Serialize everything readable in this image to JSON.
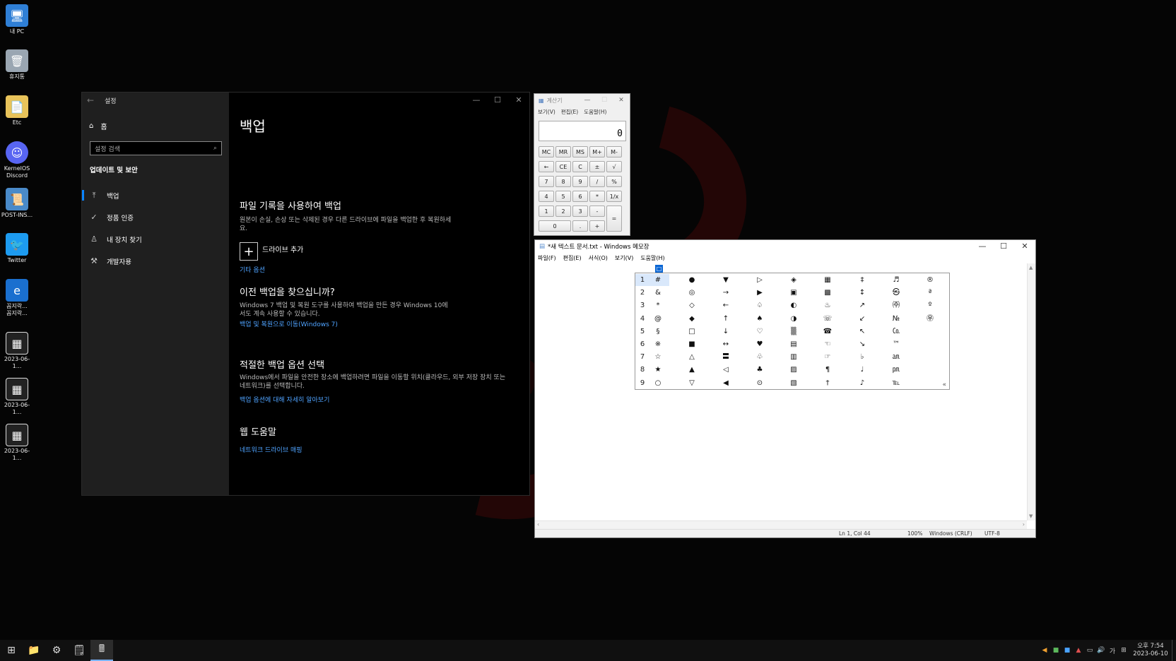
{
  "desktop": {
    "icons": [
      {
        "label": "내 PC",
        "icon": "computer-icon"
      },
      {
        "label": "휴지통",
        "icon": "recycle-bin-icon"
      },
      {
        "label": "Etc",
        "icon": "folder-icon"
      },
      {
        "label": "KernelOS Discord",
        "icon": "discord-icon"
      },
      {
        "label": "POST-INS...",
        "icon": "file-icon"
      },
      {
        "label": "Twitter",
        "icon": "twitter-icon"
      },
      {
        "label": "꼼지락...\n꼼지락...",
        "icon": "internet-explorer-icon"
      },
      {
        "label": "2023-06-1...",
        "icon": "screenshot-file-icon"
      },
      {
        "label": "2023-06-1...",
        "icon": "screenshot-file-icon"
      },
      {
        "label": "2023-06-1...",
        "icon": "screenshot-file-icon"
      }
    ]
  },
  "settings": {
    "title": "설정",
    "home": "홈",
    "search_placeholder": "설정 검색",
    "section": "업데이트 및 보안",
    "nav": [
      {
        "label": "백업",
        "icon": "backup-arrow-icon",
        "active": true
      },
      {
        "label": "정품 인증",
        "icon": "check-circle-icon",
        "active": false
      },
      {
        "label": "내 장치 찾기",
        "icon": "person-find-icon",
        "active": false
      },
      {
        "label": "개발자용",
        "icon": "developer-icon",
        "active": false
      }
    ],
    "page_title": "백업",
    "file_history_heading": "파일 기록을 사용하여 백업",
    "file_history_desc": "원본이 손실, 손상 또는 삭제된 경우 다른 드라이브에 파일을 백업한 후 복원하세요.",
    "add_drive": "드라이브 추가",
    "more_options": "기타 옵션",
    "older_backup_heading": "이전 백업을 찾으십니까?",
    "older_backup_desc": "Windows 7 백업 및 복원 도구를 사용하여 백업을 만든 경우 Windows 10에서도 계속 사용할 수 있습니다.",
    "older_backup_link": "백업 및 복원으로 이동(Windows 7)",
    "choose_heading": "적절한 백업 옵션 선택",
    "choose_desc": "Windows에서 파일을 안전한 장소에 백업하려면 파일을 이동할 위치(클라우드, 외부 저장 장치 또는 네트워크)를 선택합니다.",
    "choose_link": "백업 옵션에 대해 자세히 알아보기",
    "web_help_heading": "웹 도움말",
    "web_help_link": "네트워크 드라이브 매핑"
  },
  "calculator": {
    "title": "계산기",
    "menu": [
      "보기(V)",
      "편집(E)",
      "도움말(H)"
    ],
    "display": "0",
    "keys": [
      [
        "MC",
        "MR",
        "MS",
        "M+",
        "M-"
      ],
      [
        "←",
        "CE",
        "C",
        "±",
        "√"
      ],
      [
        "7",
        "8",
        "9",
        "/",
        "%"
      ],
      [
        "4",
        "5",
        "6",
        "*",
        "1/x"
      ],
      [
        "1",
        "2",
        "3",
        "-",
        "="
      ],
      [
        "0",
        ".",
        "+"
      ]
    ]
  },
  "notepad": {
    "title": "*새 텍스트 문서.txt - Windows 메모장",
    "menu": [
      "파일(F)",
      "편집(E)",
      "서식(O)",
      "보기(V)",
      "도움말(H)"
    ],
    "cursor_char": "□",
    "status": {
      "position": "Ln 1, Col 44",
      "zoom": "100%",
      "eol": "Windows (CRLF)",
      "encoding": "UTF-8"
    }
  },
  "ime_palette": {
    "row_numbers": [
      "1",
      "2",
      "3",
      "4",
      "5",
      "6",
      "7",
      "8",
      "9"
    ],
    "columns": [
      [
        "#",
        "&",
        "*",
        "@",
        "§",
        "※",
        "☆",
        "★",
        "○"
      ],
      [
        "●",
        "◎",
        "◇",
        "◆",
        "□",
        "■",
        "△",
        "▲",
        "▽"
      ],
      [
        "▼",
        "→",
        "←",
        "↑",
        "↓",
        "↔",
        "〓",
        "◁",
        "◀"
      ],
      [
        "▷",
        "▶",
        "♤",
        "♠",
        "♡",
        "♥",
        "♧",
        "♣",
        "⊙"
      ],
      [
        "◈",
        "▣",
        "◐",
        "◑",
        "▒",
        "▤",
        "▥",
        "▨",
        "▧"
      ],
      [
        "▦",
        "▩",
        "♨",
        "☏",
        "☎",
        "☜",
        "☞",
        "¶",
        "†"
      ],
      [
        "‡",
        "↕",
        "↗",
        "↙",
        "↖",
        "↘",
        "♭",
        "♩",
        "♪"
      ],
      [
        "♬",
        "㉿",
        "㈜",
        "№",
        "㏇",
        "™",
        "㏂",
        "㏘",
        "℡"
      ],
      [
        "®",
        "ª",
        "º",
        "㉾",
        "",
        "",
        "",
        "",
        ""
      ]
    ],
    "more": "«"
  },
  "taskbar": {
    "buttons": [
      {
        "name": "start-button",
        "icon": "windows-logo-icon",
        "glyph": "⊞"
      },
      {
        "name": "file-explorer-button",
        "icon": "folder-icon",
        "glyph": "📁"
      },
      {
        "name": "settings-button",
        "icon": "gear-icon",
        "glyph": "⚙"
      },
      {
        "name": "notepad-button",
        "icon": "notepad-icon",
        "glyph": "🗒"
      },
      {
        "name": "calculator-button",
        "icon": "calculator-icon",
        "glyph": "🖩"
      }
    ],
    "ime_mode": "가",
    "time": "오후 7:54",
    "date": "2023-06-10"
  }
}
